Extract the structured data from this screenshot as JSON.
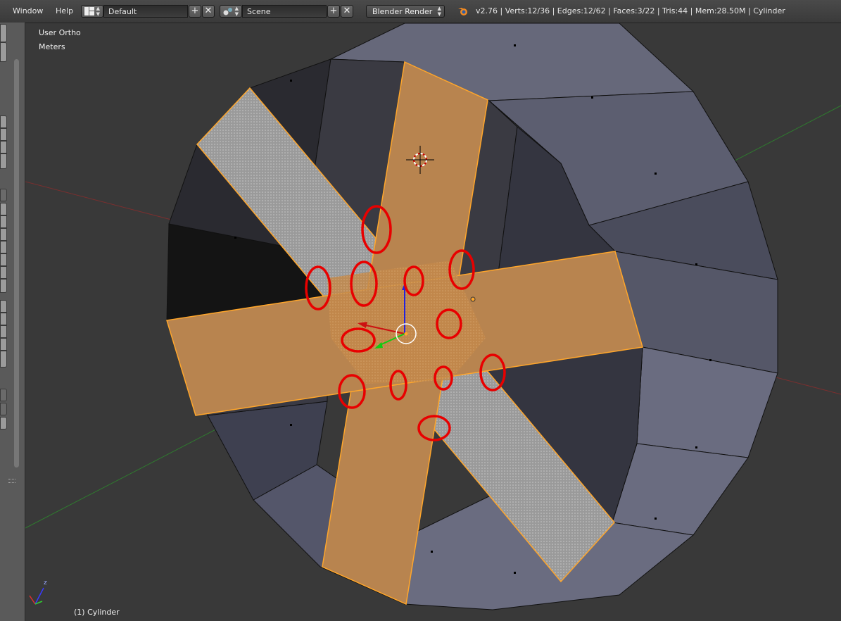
{
  "menu": {
    "window": "Window",
    "help": "Help"
  },
  "layout": {
    "value": "Default"
  },
  "scene": {
    "value": "Scene"
  },
  "render_engine": {
    "value": "Blender Render"
  },
  "stats": "v2.76 | Verts:12/36 | Edges:12/62 | Faces:3/22 | Tris:44 | Mem:28.50M | Cylinder",
  "viewport": {
    "view_label": "User Ortho",
    "units_label": "Meters",
    "object_label": "(1) Cylinder",
    "axis_z": "z"
  },
  "colors": {
    "selected_face": "#b8844f",
    "selected_edge": "#ffa62b",
    "mesh_face": "#5c5e6e",
    "annotation": "#e80000",
    "background": "#393939"
  },
  "icons": [
    "editor-type-icon",
    "scene-icon",
    "blender-logo-icon",
    "add-icon",
    "close-icon",
    "3d-cursor-icon",
    "transform-manipulator-icon"
  ]
}
